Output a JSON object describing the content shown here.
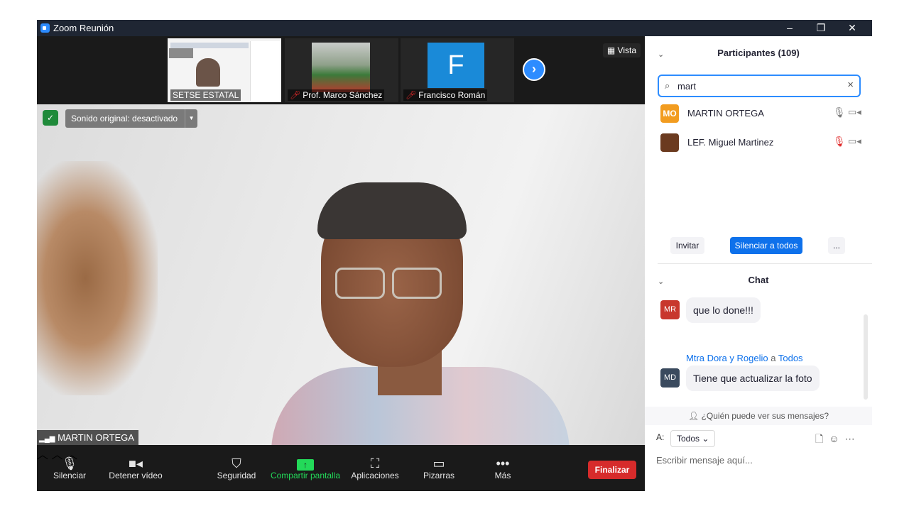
{
  "window": {
    "title": "Zoom Reunión",
    "controls": {
      "minimize": "–",
      "restore": "❐",
      "close": "✕"
    }
  },
  "thumbnails": [
    {
      "name": "SETSE ESTATAL",
      "muted": false
    },
    {
      "name": "Prof. Marco Sánchez",
      "muted": true
    },
    {
      "name": "Francisco Román",
      "muted": true,
      "initial": "F"
    }
  ],
  "view_label": "Vista",
  "next_icon": "›",
  "audio_banner": "Sonido original: desactivado",
  "active_speaker": "MARTIN ORTEGA",
  "toolbar": {
    "mute": "Silenciar",
    "stop_video": "Detener vídeo",
    "security": "Seguridad",
    "share": "Compartir pantalla",
    "apps": "Aplicaciones",
    "whiteboards": "Pizarras",
    "more": "Más",
    "end": "Finalizar"
  },
  "participants": {
    "header": "Participantes (109)",
    "search_value": "mart",
    "items": [
      {
        "initials": "MO",
        "name": "MARTIN ORTEGA",
        "avatar_color": "#f29c1f",
        "muted": false
      },
      {
        "initials": "",
        "name": "LEF. Miguel Martinez",
        "avatar_color": "#6b3a1f",
        "muted": true
      }
    ],
    "invite": "Invitar",
    "mute_all": "Silenciar a todos",
    "more": "..."
  },
  "chat": {
    "header": "Chat",
    "messages": [
      {
        "initials": "MR",
        "avatar_color": "#c8372d",
        "text": "que lo done!!!"
      },
      {
        "initials": "MD",
        "avatar_color": "#3a4a5e",
        "sender": "Mtra Dora y Rogelio",
        "to_word": "a",
        "recipient": "Todos",
        "text": "Tiene que actualizar la foto"
      }
    ],
    "visibility": "¿Quién puede ver sus mensajes?",
    "to_label": "A:",
    "to_value": "Todos",
    "placeholder": "Escribir mensaje aquí..."
  },
  "colors": {
    "accent": "#2d8cff",
    "end_button": "#d62b2b",
    "share_green": "#23d959",
    "muted_red": "#e02828"
  }
}
